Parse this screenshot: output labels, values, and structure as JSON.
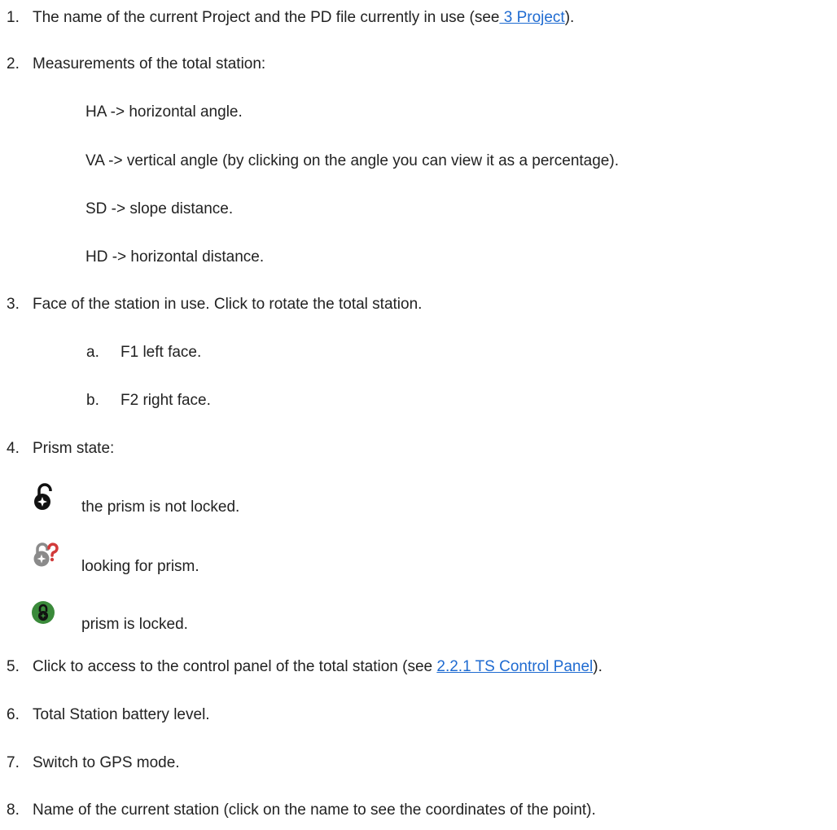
{
  "items": [
    {
      "num": "1.",
      "before": "The name of the current Project and the PD file currently in use (see",
      "link": " 3 Project",
      "after": ")."
    },
    {
      "num": "2.",
      "text": "Measurements of the total station:"
    },
    {
      "num": "3.",
      "text": "Face of the station in use. Click to rotate the total station."
    },
    {
      "num": "4.",
      "text": "Prism state:"
    },
    {
      "num": "5.",
      "before": "Click to access to the control panel of the total station (see ",
      "link": "2.2.1 TS Control Panel",
      "after": ")."
    },
    {
      "num": "6.",
      "text": "Total Station battery level."
    },
    {
      "num": "7.",
      "text": "Switch to GPS mode."
    },
    {
      "num": "8.",
      "text": "Name of the current station (click on the name to see the coordinates of the point)."
    }
  ],
  "measurements": [
    "HA -> horizontal angle.",
    "VA -> vertical angle (by clicking on the angle you can view it as a percentage).",
    "SD -> slope distance.",
    "HD -> horizontal distance."
  ],
  "faces": [
    {
      "letter": "a.",
      "text": "F1 left face."
    },
    {
      "letter": "b.",
      "text": "F2 right face."
    }
  ],
  "prism_states": [
    {
      "icon": "unlocked-padlock-icon",
      "text": "the prism is not locked."
    },
    {
      "icon": "searching-padlock-icon",
      "text": "looking for prism."
    },
    {
      "icon": "locked-padlock-icon",
      "text": "prism is locked."
    }
  ],
  "colors": {
    "link": "#1f6bd1",
    "text": "#222222",
    "locked": "#3a8a3a",
    "search": "#d23a3a"
  }
}
